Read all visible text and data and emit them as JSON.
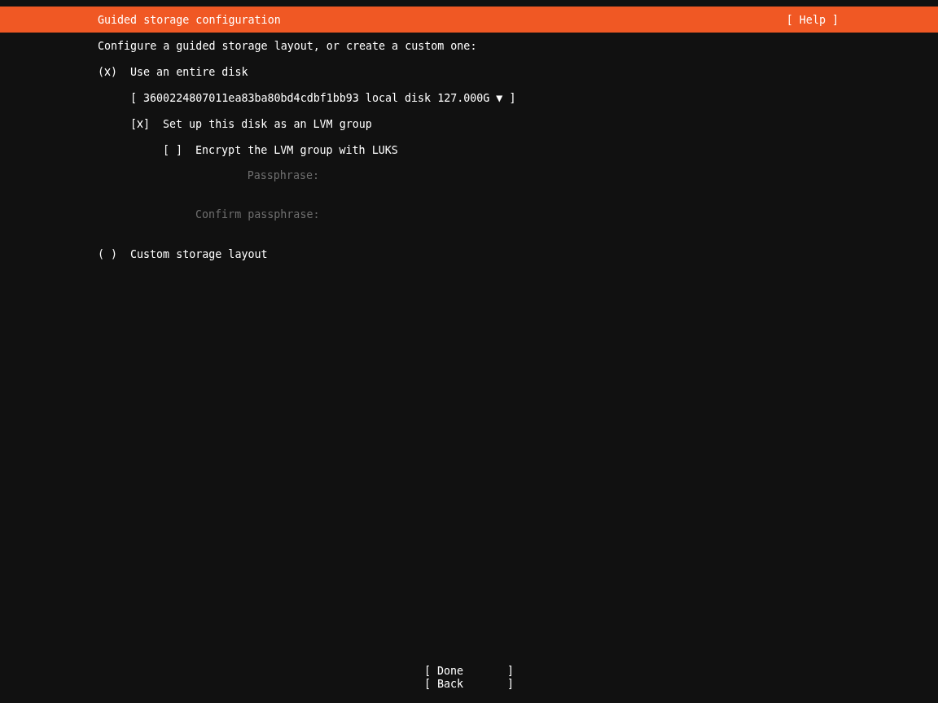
{
  "header": {
    "title": "Guided storage configuration",
    "help": "Help"
  },
  "brackets": {
    "radio": [
      "(",
      ")"
    ],
    "box": [
      "[",
      "]"
    ]
  },
  "intro": "Configure a guided storage layout, or create a custom one:",
  "options": [
    {
      "label": "Use an entire disk",
      "selected": true,
      "disk": {
        "value": "3600224807011ea83ba80bd4cdbf1bb93 local disk 127.000G",
        "arrow": "▼"
      },
      "lvm": {
        "label": "Set up this disk as an LVM group",
        "checked": true,
        "encrypt": {
          "label": "Encrypt the LVM group with LUKS",
          "checked": false,
          "fields": [
            {
              "label": "Passphrase:",
              "disabled": true
            },
            {
              "label": "Confirm passphrase:",
              "disabled": true
            }
          ]
        }
      }
    },
    {
      "label": "Custom storage layout",
      "selected": false
    }
  ],
  "buttons": [
    {
      "label": "Done"
    },
    {
      "label": "Back"
    }
  ]
}
